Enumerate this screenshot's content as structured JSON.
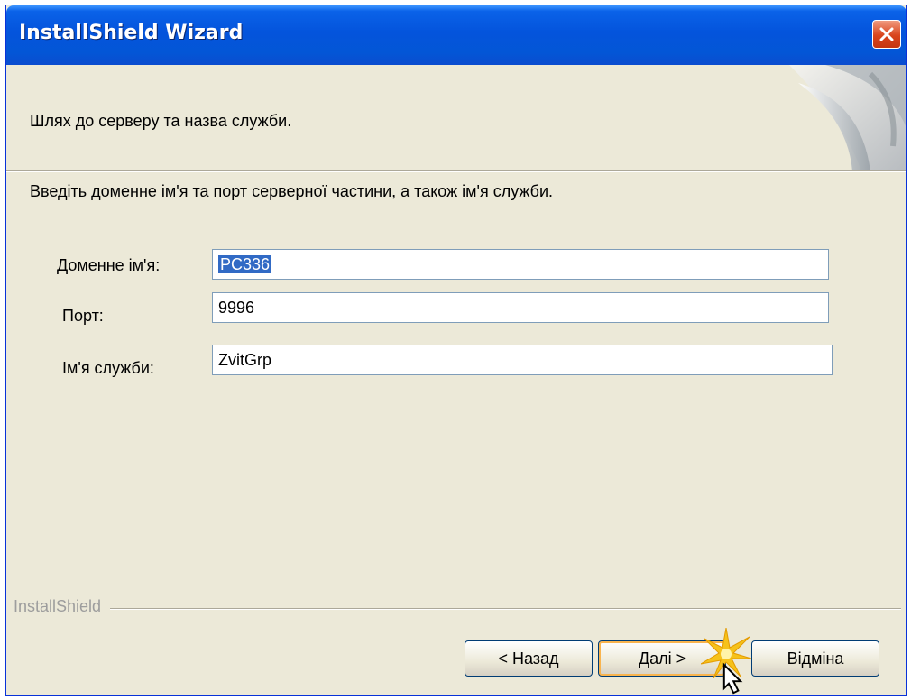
{
  "window": {
    "title": "InstallShield Wizard",
    "close_icon": "close-icon"
  },
  "header": {
    "text": "Шлях до серверу та назва служби."
  },
  "instruction": "Введіть доменне ім'я та порт серверної частини, а також ім'я служби.",
  "fields": [
    {
      "label": "Доменне ім'я:",
      "value": "PC336",
      "selected": true
    },
    {
      "label": "Порт:",
      "value": "9996",
      "selected": false
    },
    {
      "label": "Ім'я служби:",
      "value": "ZvitGrp",
      "selected": false
    }
  ],
  "footer": {
    "brand": "InstallShield"
  },
  "buttons": {
    "back": "< Назад",
    "next": "Далі >",
    "cancel": "Відміна"
  },
  "colors": {
    "titlebar": "#0454dc",
    "dialog_bg": "#ece9d8",
    "selection": "#316ac5",
    "default_button_glow": "#f9b44e"
  }
}
